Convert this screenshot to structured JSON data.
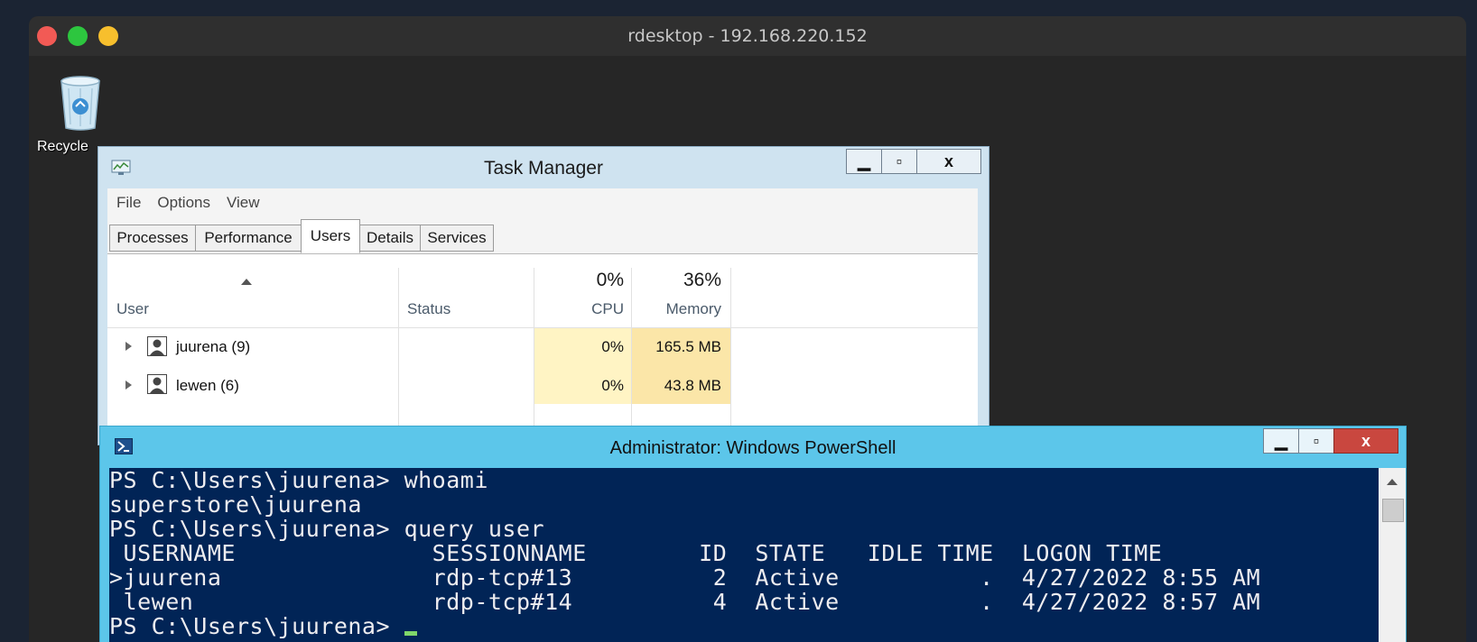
{
  "mac": {
    "title": "rdesktop - 192.168.220.152"
  },
  "desktop": {
    "recycle_label": "Recycle"
  },
  "taskmgr": {
    "title": "Task Manager",
    "menu": [
      "File",
      "Options",
      "View"
    ],
    "tabs": [
      "Processes",
      "Performance",
      "Users",
      "Details",
      "Services"
    ],
    "active_tab": "Users",
    "columns": {
      "user": "User",
      "status": "Status",
      "cpu_pct": "0%",
      "cpu": "CPU",
      "mem_pct": "36%",
      "memory": "Memory"
    },
    "rows": [
      {
        "user": "juurena (9)",
        "cpu": "0%",
        "memory": "165.5 MB"
      },
      {
        "user": "lewen (6)",
        "cpu": "0%",
        "memory": "43.8 MB"
      }
    ],
    "buttons": {
      "min": "▁",
      "max": "▫",
      "close": "x"
    }
  },
  "powershell": {
    "title": "Administrator: Windows PowerShell",
    "lines": [
      "PS C:\\Users\\juurena> whoami",
      "superstore\\juurena",
      "PS C:\\Users\\juurena> query user",
      " USERNAME              SESSIONNAME        ID  STATE   IDLE TIME  LOGON TIME",
      ">juurena               rdp-tcp#13          2  Active          .  4/27/2022 8:55 AM",
      " lewen                 rdp-tcp#14          4  Active          .  4/27/2022 8:57 AM"
    ],
    "prompt": "PS C:\\Users\\juurena> ",
    "buttons": {
      "min": "▁",
      "max": "▫",
      "close": "x"
    }
  },
  "colors": {
    "ps_bg": "#012456",
    "ps_chrome": "#5cc6ea",
    "tm_chrome": "#cfe3f0",
    "heat": "#fff4c4",
    "cursor": "#7fd66a"
  }
}
